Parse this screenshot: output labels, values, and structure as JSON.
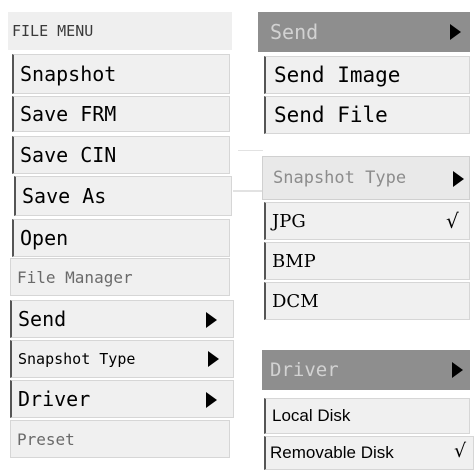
{
  "file_menu": {
    "title": "FILE MENU",
    "items": [
      "Snapshot",
      "Save FRM",
      "Save CIN",
      "Save As",
      "Open",
      "File Manager",
      "Send",
      "Snapshot Type",
      "Driver",
      "Preset"
    ]
  },
  "send_menu": {
    "title": "Send",
    "items": [
      "Send Image",
      "Send File"
    ]
  },
  "snapshot_type_menu": {
    "title": "Snapshot Type",
    "items": [
      "JPG",
      "BMP",
      "DCM"
    ],
    "checkmark": "√"
  },
  "driver_menu": {
    "title": "Driver",
    "items": [
      "Local Disk",
      "Removable Disk"
    ],
    "checkmark": "√"
  },
  "icons": {
    "submenu": "triangle-right-icon",
    "check": "check-icon"
  },
  "colors": {
    "panel": "#f0f0f0",
    "header": "#8e8e8e",
    "header_text": "#d2d2d2",
    "disabled_text": "#6a6a6a"
  }
}
